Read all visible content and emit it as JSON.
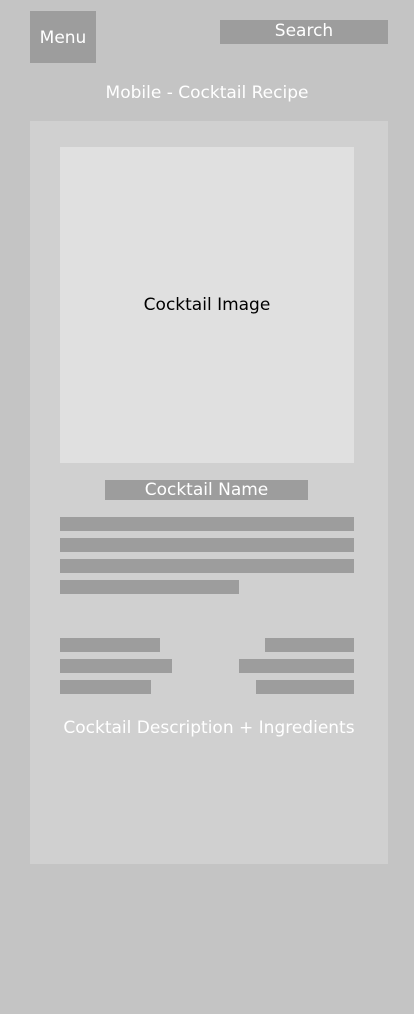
{
  "header": {
    "menu_label": "Menu",
    "search_label": "Search"
  },
  "page": {
    "title": "Mobile - Cocktail Recipe"
  },
  "recipe": {
    "image_label": "Cocktail Image",
    "name_label": "Cocktail Name",
    "description_label": "Cocktail Description + Ingredients"
  },
  "colors": {
    "background": "#c4c4c4",
    "card": "#d0d0d0",
    "image_placeholder": "#e0e0e0",
    "placeholder_bar": "#9d9d9d",
    "text_light": "#ffffff",
    "text_dark": "#000000"
  }
}
